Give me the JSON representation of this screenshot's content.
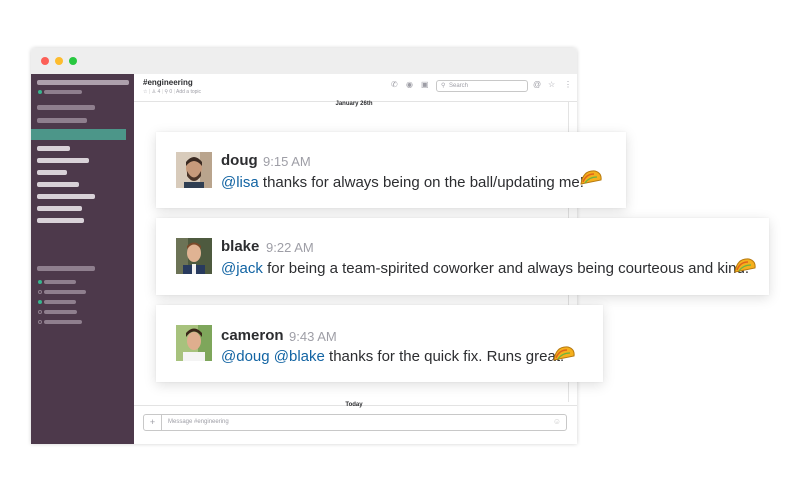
{
  "channel": {
    "name": "#engineering",
    "stars": "☆",
    "members": "♙ 4",
    "pins": "⚲ 0",
    "topic": "Add a topic"
  },
  "header": {
    "search_placeholder": "Search"
  },
  "timeline": {
    "date_label": "January 26th",
    "today_label": "Today"
  },
  "composer": {
    "add_label": "+",
    "placeholder": "Message #engineering"
  },
  "messages": [
    {
      "user": "doug",
      "time": "9:15 AM",
      "mentions": [
        "@lisa"
      ],
      "text": " thanks for always being on the ball/updating me!"
    },
    {
      "user": "blake",
      "time": "9:22 AM",
      "mentions": [
        "@jack"
      ],
      "text": " for being a team-spirited coworker and always being courteous and kind."
    },
    {
      "user": "cameron",
      "time": "9:43 AM",
      "mentions": [
        "@doug",
        "@blake"
      ],
      "text": " thanks for the quick fix. Runs great!"
    }
  ],
  "colors": {
    "sidebar_bg": "#4d394b",
    "sidebar_active": "#4c9689",
    "mention": "#1264a3",
    "taco": "#f5b01c"
  },
  "icons": {
    "reaction": "taco-icon"
  }
}
